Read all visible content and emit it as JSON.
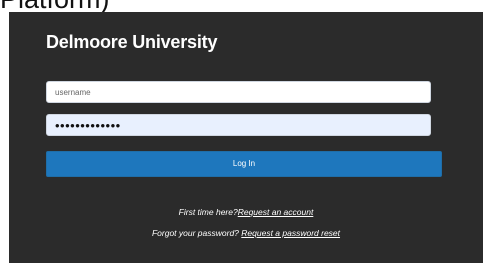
{
  "page": {
    "caption": "Platform)"
  },
  "brand": {
    "title": "Delmoore University"
  },
  "login_form": {
    "username_placeholder": "username",
    "username_value": "",
    "password_value": "•••••••••••••",
    "login_button_label": "Log In"
  },
  "help": {
    "first_time_text": "First time here?",
    "request_account_link": "Request an account",
    "forgot_password_text": "Forgot your password? ",
    "password_reset_link": "Request a password reset"
  },
  "colors": {
    "panel_background": "#2b2b2b",
    "button_background": "#1e77bd",
    "text_light": "#ffffff"
  }
}
